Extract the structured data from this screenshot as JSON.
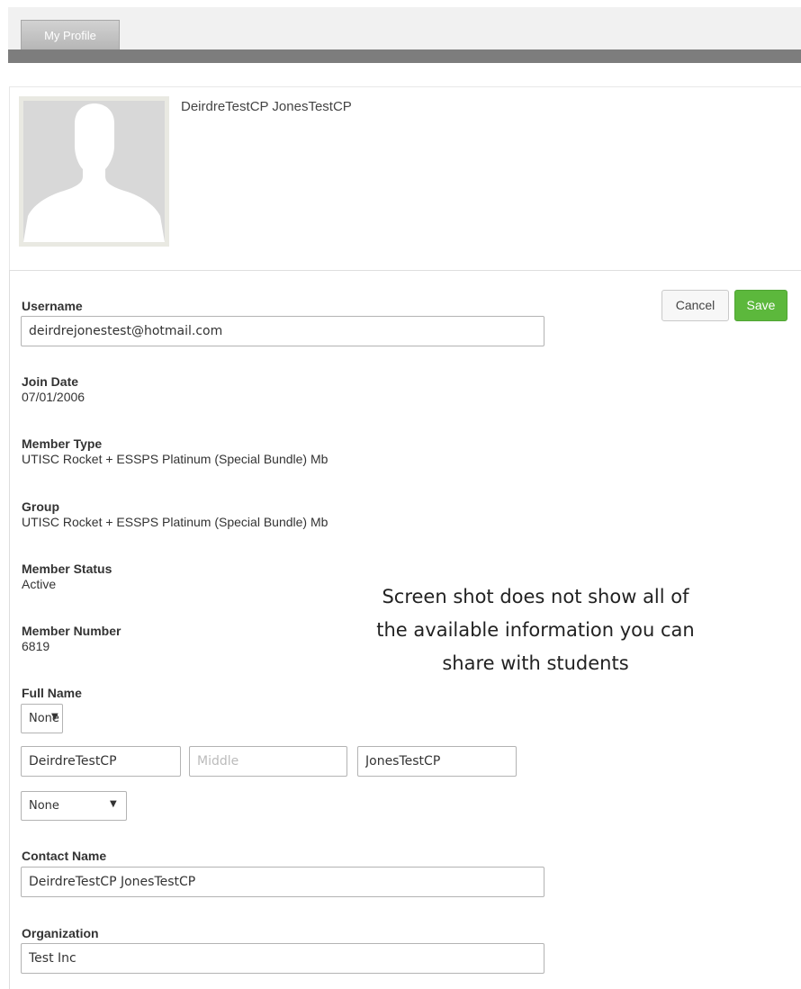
{
  "tabs": {
    "my_profile": "My Profile"
  },
  "profile": {
    "display_name": "DeirdreTestCP JonesTestCP"
  },
  "actions": {
    "cancel": "Cancel",
    "save": "Save"
  },
  "fields": {
    "username": {
      "label": "Username",
      "value": "deirdrejonestest@hotmail.com"
    },
    "join_date": {
      "label": "Join Date",
      "value": "07/01/2006"
    },
    "member_type": {
      "label": "Member Type",
      "value": "UTISC Rocket + ESSPS Platinum (Special Bundle) Mb"
    },
    "group": {
      "label": "Group",
      "value": "UTISC Rocket + ESSPS Platinum (Special Bundle) Mb"
    },
    "member_status": {
      "label": "Member Status",
      "value": "Active"
    },
    "member_number": {
      "label": "Member Number",
      "value": "6819"
    },
    "full_name": {
      "label": "Full Name",
      "prefix": "None",
      "first": "DeirdreTestCP",
      "middle_placeholder": "Middle",
      "middle": "",
      "last": "JonesTestCP",
      "suffix": "None"
    },
    "contact_name": {
      "label": "Contact Name",
      "value": "DeirdreTestCP JonesTestCP"
    },
    "organization": {
      "label": "Organization",
      "value": "Test Inc"
    }
  },
  "note": {
    "line1": "Screen shot does not show all of",
    "line2": "the available information you can",
    "line3": "share with students"
  },
  "icons": {
    "avatar": "person-silhouette-icon",
    "dropdown": "triangle-down-icon"
  },
  "colors": {
    "save_button": "#5cb83c",
    "tab_bar": "#7d7d7d"
  }
}
